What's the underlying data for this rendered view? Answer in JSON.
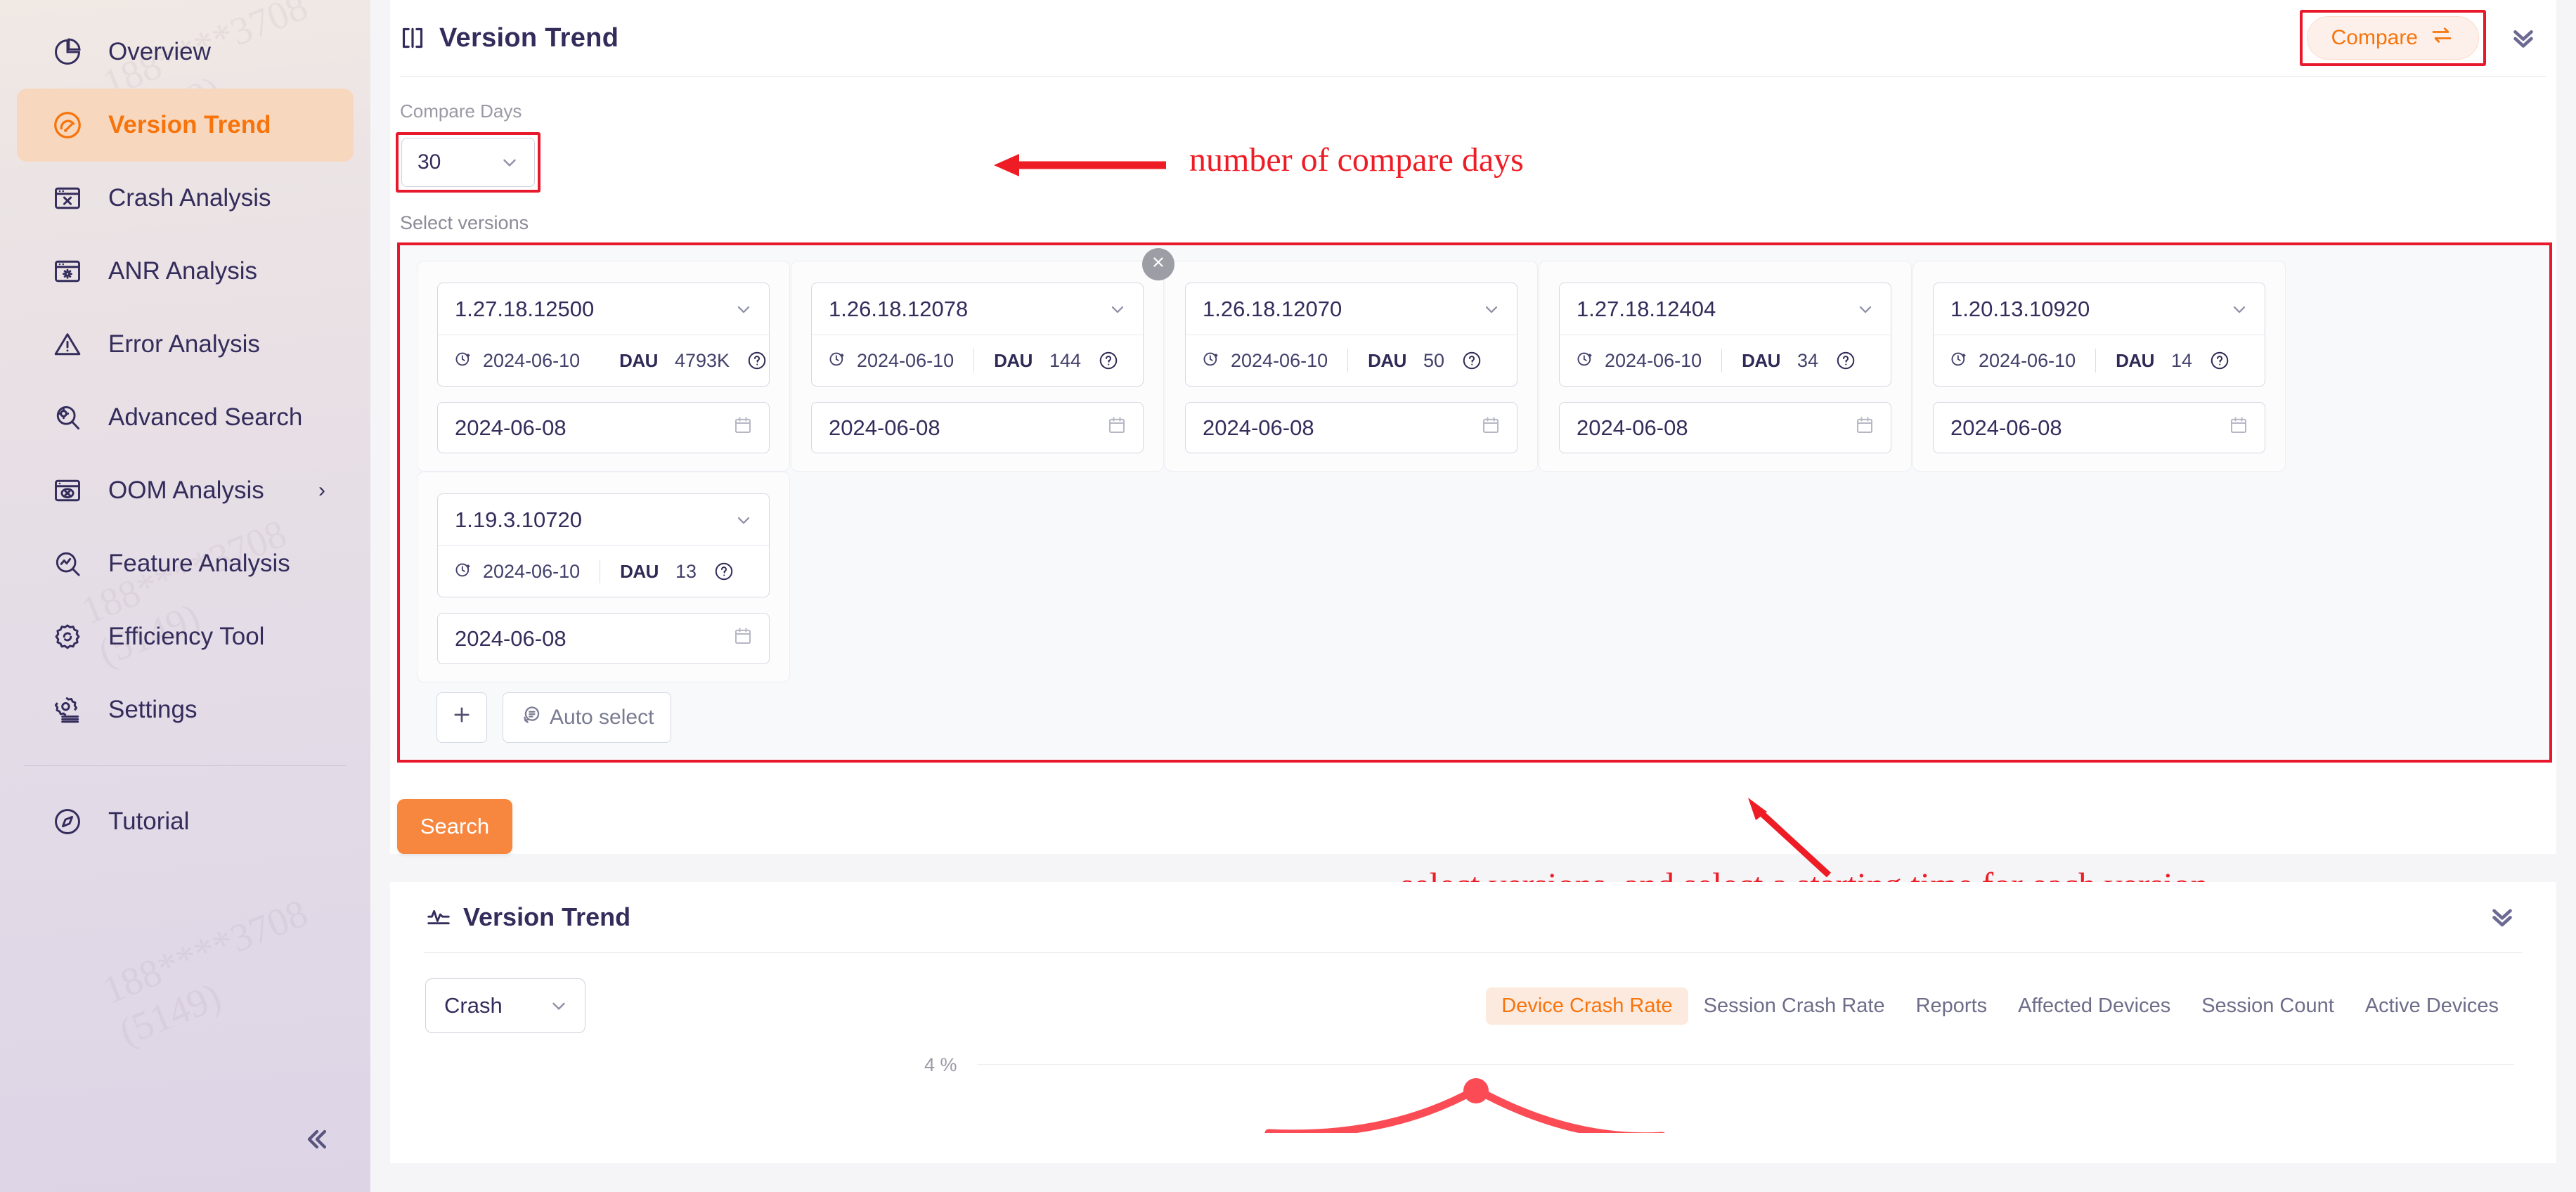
{
  "sidebar": {
    "items": [
      {
        "label": "Overview",
        "icon": "pie-chart-icon",
        "active": false,
        "expandable": false
      },
      {
        "label": "Version Trend",
        "icon": "gauge-icon",
        "active": true,
        "expandable": false
      },
      {
        "label": "Crash Analysis",
        "icon": "window-x-icon",
        "active": false,
        "expandable": false
      },
      {
        "label": "ANR Analysis",
        "icon": "window-spinner-icon",
        "active": false,
        "expandable": false
      },
      {
        "label": "Error Analysis",
        "icon": "warning-triangle-icon",
        "active": false,
        "expandable": false
      },
      {
        "label": "Advanced Search",
        "icon": "search-gear-icon",
        "active": false,
        "expandable": false
      },
      {
        "label": "OOM Analysis",
        "icon": "window-oom-icon",
        "active": false,
        "expandable": true
      },
      {
        "label": "Feature Analysis",
        "icon": "trend-search-icon",
        "active": false,
        "expandable": false
      },
      {
        "label": "Efficiency Tool",
        "icon": "gear-refresh-icon",
        "active": false,
        "expandable": false
      },
      {
        "label": "Settings",
        "icon": "settings-gear-icon",
        "active": false,
        "expandable": false
      }
    ],
    "footer_items": [
      {
        "label": "Tutorial",
        "icon": "compass-icon",
        "active": false,
        "expandable": false
      }
    ],
    "collapse_icon": "double-chevron-left-icon",
    "expand_arrow": "›",
    "watermark": "188****3708\n(5149)"
  },
  "header": {
    "icon": "panel-brackets-icon",
    "title": "Version Trend",
    "compare_label": "Compare",
    "compare_icon": "swap-arrows-icon",
    "collapse_icon": "double-chevron-down-icon"
  },
  "filters": {
    "compare_days_label": "Compare Days",
    "compare_days_value": "30",
    "select_versions_label": "Select versions",
    "add_icon": "plus-icon",
    "auto_select_label": "Auto select",
    "auto_select_icon": "auto-refresh-icon",
    "search_label": "Search",
    "close_icon": "close-x-icon",
    "calendar_icon": "calendar-icon",
    "clock_icon": "clock-up-icon",
    "help_icon": "question-circle-icon",
    "dau_label": "DAU",
    "chevron_icon": "chevron-down-icon"
  },
  "versions": [
    {
      "version": "1.27.18.12500",
      "release_date": "2024-06-10",
      "dau": "4793K",
      "start_date": "2024-06-08",
      "removable": false
    },
    {
      "version": "1.26.18.12078",
      "release_date": "2024-06-10",
      "dau": "144",
      "start_date": "2024-06-08",
      "removable": true
    },
    {
      "version": "1.26.18.12070",
      "release_date": "2024-06-10",
      "dau": "50",
      "start_date": "2024-06-08",
      "removable": false
    },
    {
      "version": "1.27.18.12404",
      "release_date": "2024-06-10",
      "dau": "34",
      "start_date": "2024-06-08",
      "removable": false
    },
    {
      "version": "1.20.13.10920",
      "release_date": "2024-06-10",
      "dau": "14",
      "start_date": "2024-06-08",
      "removable": false
    },
    {
      "version": "1.19.3.10720",
      "release_date": "2024-06-10",
      "dau": "13",
      "start_date": "2024-06-08",
      "removable": false
    }
  ],
  "annotations": [
    {
      "id": "compare-days-note",
      "text": "number of compare days",
      "color": "#ee1c25"
    },
    {
      "id": "select-versions-note",
      "text": "select versions, and select a starting time for each version",
      "color": "#ee1c25"
    }
  ],
  "trend_panel": {
    "icon": "pulse-line-icon",
    "title": "Version Trend",
    "collapse_icon": "double-chevron-down-icon",
    "metric_value": "Crash",
    "tabs": [
      {
        "label": "Device Crash Rate",
        "active": true
      },
      {
        "label": "Session Crash Rate",
        "active": false
      },
      {
        "label": "Reports",
        "active": false
      },
      {
        "label": "Affected Devices",
        "active": false
      },
      {
        "label": "Session Count",
        "active": false
      },
      {
        "label": "Active Devices",
        "active": false
      }
    ]
  },
  "chart_data": {
    "type": "line",
    "title": "Version Trend",
    "ylabel": "",
    "xlabel": "",
    "ytick_labels": [
      "4 %"
    ],
    "ylim": [
      0,
      4
    ],
    "grid": true,
    "series": [
      {
        "name": "1.27.18.12500",
        "color": "#fb4b55",
        "values": [
          3.2,
          3.9,
          3.4
        ]
      }
    ],
    "legend_position": "none"
  },
  "theme": {
    "accent": "#f7740c",
    "search_button": "#f7873f",
    "annotation_red": "#ee1c25",
    "sidebar_active_bg": "#f7d8bf",
    "text_dark": "#342d5c",
    "chart_line": "#fb4b55"
  }
}
